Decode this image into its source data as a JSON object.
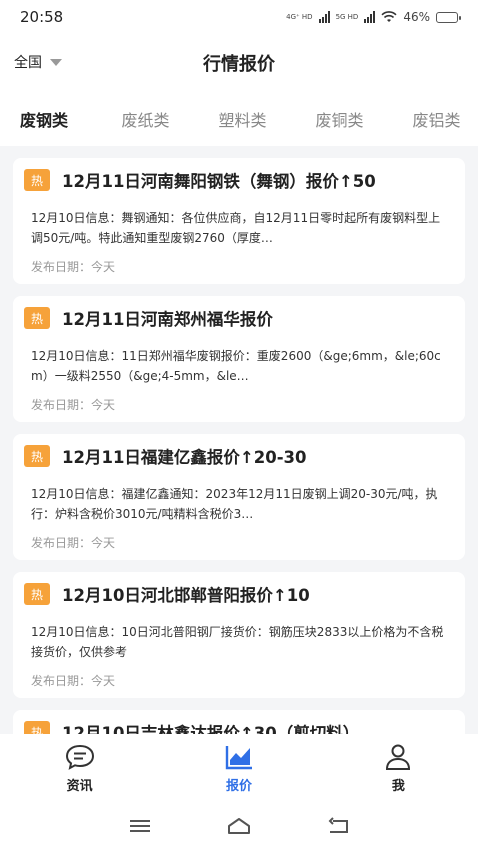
{
  "status": {
    "time": "20:58",
    "net1": "4G⁺ HD",
    "net2": "5G HD",
    "battery": "46%",
    "battery_level": 0.46
  },
  "header": {
    "region": "全国",
    "title": "行情报价"
  },
  "tabs": [
    "废钢类",
    "废纸类",
    "塑料类",
    "废铜类",
    "废铝类"
  ],
  "articles": [
    {
      "badge": "热",
      "title": "12月11日河南舞阳钢铁（舞钢）报价↑50",
      "summary": "12月10日信息：舞钢通知：各位供应商，自12月11日零时起所有废钢料型上调50元/吨。特此通知重型废钢2760（厚度…",
      "date": "发布日期：今天"
    },
    {
      "badge": "热",
      "title": "12月11日河南郑州福华报价",
      "summary": "12月10日信息：11日郑州福华废钢报价：重废2600（&ge;6mm，&le;60cm）一级料2550（&ge;4-5mm，&le…",
      "date": "发布日期：今天"
    },
    {
      "badge": "热",
      "title": "12月11日福建亿鑫报价↑20-30",
      "summary": "12月10日信息：福建亿鑫通知：2023年12月11日废钢上调20-30元/吨，执行：炉料含税价3010元/吨精料含税价3…",
      "date": "发布日期：今天"
    },
    {
      "badge": "热",
      "title": "12月10日河北邯郸普阳报价↑10",
      "summary": "12月10日信息：10日河北普阳钢厂接货价：钢筋压块2833以上价格为不含税接货价，仅供参考",
      "date": "发布日期：今天"
    },
    {
      "badge": "热",
      "title": "12月10日吉林鑫达报价↑30（剪切料）",
      "summary": "",
      "date": ""
    }
  ],
  "nav": {
    "news": "资讯",
    "quote": "报价",
    "me": "我"
  },
  "colors": {
    "accent": "#2f6fe6",
    "badge": "#f6a23a"
  }
}
